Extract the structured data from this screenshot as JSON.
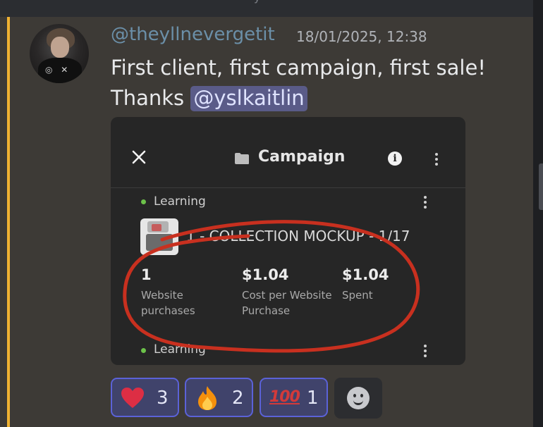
{
  "top_fragment": "y",
  "message": {
    "author": "@theyllnevergetit",
    "timestamp": "18/01/2025, 12:38",
    "line1": "First client, first campaign, first sale!",
    "line2_prefix": "Thanks ",
    "mention": "@yslkaitlin"
  },
  "embed": {
    "title": "Campaign",
    "status_top": "Learning",
    "ad_name": "1 - COLLECTION MOCKUP - 1/17",
    "metrics": [
      {
        "value": "1",
        "label_line1": "Website",
        "label_line2": "purchases"
      },
      {
        "value": "$1.04",
        "label_line1": "Cost per Website",
        "label_line2": "Purchase"
      },
      {
        "value": "$1.04",
        "label_line1": "Spent",
        "label_line2": ""
      }
    ],
    "status_bottom": "Learning"
  },
  "reactions": [
    {
      "emoji": "heart",
      "count": "3"
    },
    {
      "emoji": "fire",
      "count": "2"
    },
    {
      "emoji": "hundred-points",
      "count": "1"
    }
  ],
  "icons": [
    "close-icon",
    "folder-icon",
    "info-icon",
    "more-vertical-icon",
    "heart-icon",
    "fire-icon",
    "hundred-points-icon",
    "add-reaction-icon"
  ],
  "colors": {
    "highlight_bar": "#f0b232",
    "username": "#6b8fa8",
    "mention_bg": "#5a5b88",
    "annotation_circle": "#c8301f",
    "reaction_border": "#5b62d8",
    "status_dot": "#6cc24a"
  }
}
